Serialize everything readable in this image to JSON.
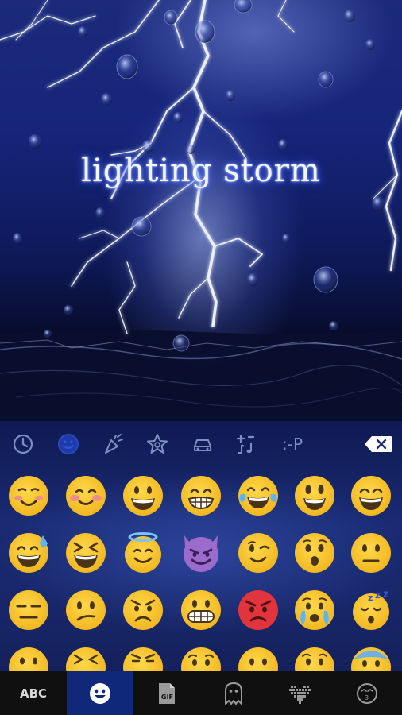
{
  "wallpaper": {
    "title": "lighting storm",
    "glow_color": "#3c5cff"
  },
  "emoji_categories": [
    {
      "name": "recent",
      "icon": "clock-icon"
    },
    {
      "name": "smileys",
      "icon": "smiley-icon",
      "selected": true
    },
    {
      "name": "celebration",
      "icon": "party-popper-icon"
    },
    {
      "name": "nature",
      "icon": "star-icon"
    },
    {
      "name": "travel",
      "icon": "car-icon"
    },
    {
      "name": "symbols",
      "icon": "music-symbols-icon"
    },
    {
      "name": "emoticons",
      "icon": "emoticon-text",
      "label": ":-P"
    }
  ],
  "delete_key": {
    "icon": "backspace-icon"
  },
  "emoji_grid": [
    [
      "smiling-blushing",
      "smiling-eyes-blush",
      "grinning",
      "grimacing-grin",
      "tears-of-joy",
      "grinning-big-eyes",
      "grinning-squint"
    ],
    [
      "grinning-sweat",
      "laughing-squint",
      "smiling-halo",
      "smiling-devil",
      "winking",
      "hushed",
      "neutral-face"
    ],
    [
      "expressionless",
      "confused",
      "angry",
      "grimacing",
      "pouting-red",
      "crying",
      "sleeping"
    ],
    [
      "partial-hushed",
      "partial-confounded",
      "partial-persevering",
      "partial-worried",
      "partial-neutral",
      "partial-anguished",
      "partial-anxious"
    ]
  ],
  "bottom_bar": {
    "tabs": [
      {
        "name": "abc",
        "label": "ABC"
      },
      {
        "name": "emoji",
        "icon": "smiley-icon",
        "active": true
      },
      {
        "name": "gif",
        "icon": "gif-icon",
        "label": "GIF"
      },
      {
        "name": "sticker",
        "icon": "ghost-icon"
      },
      {
        "name": "text-art",
        "icon": "pixel-heart-icon"
      },
      {
        "name": "kaomoji",
        "icon": "kaomoji-face-icon",
        "label": "3"
      }
    ]
  },
  "colors": {
    "emoji_yellow": "#f9c733",
    "emoji_mouth": "#4a3418",
    "devil_purple": "#9b6bcd",
    "angry_red": "#e2343c",
    "active_tab": "#10287a",
    "icon_muted": "#7d8fc0"
  }
}
